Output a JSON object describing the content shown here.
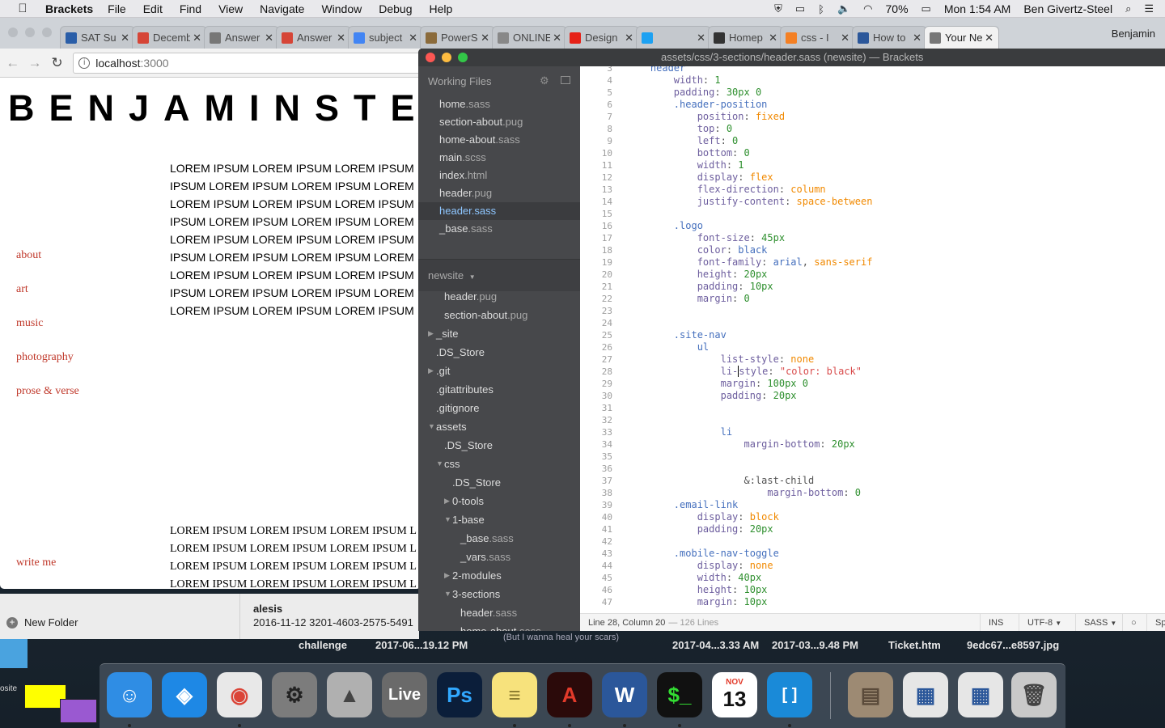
{
  "menubar": {
    "app_name": "Brackets",
    "menus": [
      "File",
      "Edit",
      "Find",
      "View",
      "Navigate",
      "Window",
      "Debug",
      "Help"
    ],
    "battery": "70%",
    "clock": "Mon 1:54 AM",
    "user": "Ben Givertz-Steel"
  },
  "chrome": {
    "tabs": [
      {
        "title": "SAT Su",
        "icon": "shield-icon",
        "color": "#2a5ea8"
      },
      {
        "title": "Decemb",
        "icon": "gmail-icon",
        "color": "#d64537"
      },
      {
        "title": "Answer",
        "icon": "document-icon",
        "color": "#777777"
      },
      {
        "title": "Answer",
        "icon": "pdf-icon",
        "color": "#d64537"
      },
      {
        "title": "subject",
        "icon": "google-icon",
        "color": "#4285f4"
      },
      {
        "title": "PowerS",
        "icon": "powerschool-icon",
        "color": "#8b6b3b"
      },
      {
        "title": "ONLINE",
        "icon": "page-icon",
        "color": "#888888"
      },
      {
        "title": "Design",
        "icon": "youtube-icon",
        "color": "#e62117"
      },
      {
        "title": "",
        "icon": "twitter-icon",
        "color": "#1da1f2"
      },
      {
        "title": "Homep",
        "icon": "grid-icon",
        "color": "#333333"
      },
      {
        "title": "css - I",
        "icon": "stack-icon",
        "color": "#f48024"
      },
      {
        "title": "How to",
        "icon": "word-icon",
        "color": "#2b579a"
      },
      {
        "title": "Your Ne",
        "icon": "document-icon",
        "color": "#777777"
      }
    ],
    "profile": "Benjamin",
    "url_host": "localhost",
    "url_port": ":3000"
  },
  "site": {
    "logo": "BENJAMINSTEEL",
    "nav": [
      "about",
      "art",
      "music",
      "photography",
      "prose & verse"
    ],
    "write_me": "write me",
    "lorem_lines": [
      "LOREM IPSUM LOREM IPSUM LOREM IPSUM",
      "IPSUM LOREM IPSUM LOREM IPSUM LOREM",
      "LOREM IPSUM LOREM IPSUM LOREM IPSUM",
      "IPSUM LOREM IPSUM LOREM IPSUM LOREM",
      "LOREM IPSUM LOREM IPSUM LOREM IPSUM",
      "IPSUM LOREM IPSUM LOREM IPSUM LOREM",
      "LOREM IPSUM LOREM IPSUM LOREM IPSUM",
      "IPSUM LOREM IPSUM LOREM IPSUM LOREM",
      "LOREM IPSUM LOREM IPSUM LOREM IPSUM"
    ],
    "lorem_lines_2": [
      "LOREM IPSUM LOREM IPSUM LOREM IPSUM L",
      "LOREM IPSUM LOREM IPSUM LOREM IPSUM L",
      "LOREM IPSUM LOREM IPSUM LOREM IPSUM L",
      "LOREM IPSUM LOREM IPSUM LOREM IPSUM L"
    ]
  },
  "finder": {
    "new_folder": "New Folder",
    "item_name": "alesis",
    "item_meta": "2016-11-12  3201-4603-2575-5491"
  },
  "brackets": {
    "title": "assets/css/3-sections/header.sass (newsite) — Brackets",
    "working_files_label": "Working Files",
    "working_files": [
      {
        "name": "home",
        "ext": ".sass",
        "selected": false
      },
      {
        "name": "section-about",
        "ext": ".pug",
        "selected": false
      },
      {
        "name": "home-about",
        "ext": ".sass",
        "selected": false
      },
      {
        "name": "main",
        "ext": ".scss",
        "selected": false
      },
      {
        "name": "index",
        "ext": ".html",
        "selected": false
      },
      {
        "name": "header",
        "ext": ".pug",
        "selected": false
      },
      {
        "name": "header",
        "ext": ".sass",
        "selected": true
      },
      {
        "name": "_base",
        "ext": ".sass",
        "selected": false
      }
    ],
    "project_name": "newsite",
    "tree": [
      {
        "name": "header",
        "ext": ".pug",
        "depth": 2,
        "twisty": ""
      },
      {
        "name": "section-about",
        "ext": ".pug",
        "depth": 2,
        "twisty": ""
      },
      {
        "name": "_site",
        "ext": "",
        "depth": 1,
        "twisty": "▶"
      },
      {
        "name": ".DS_Store",
        "ext": "",
        "depth": 1,
        "twisty": ""
      },
      {
        "name": ".git",
        "ext": "",
        "depth": 1,
        "twisty": "▶"
      },
      {
        "name": ".gitattributes",
        "ext": "",
        "depth": 1,
        "twisty": ""
      },
      {
        "name": ".gitignore",
        "ext": "",
        "depth": 1,
        "twisty": ""
      },
      {
        "name": "assets",
        "ext": "",
        "depth": 1,
        "twisty": "▼"
      },
      {
        "name": ".DS_Store",
        "ext": "",
        "depth": 2,
        "twisty": ""
      },
      {
        "name": "css",
        "ext": "",
        "depth": 2,
        "twisty": "▼"
      },
      {
        "name": ".DS_Store",
        "ext": "",
        "depth": 3,
        "twisty": ""
      },
      {
        "name": "0-tools",
        "ext": "",
        "depth": 3,
        "twisty": "▶"
      },
      {
        "name": "1-base",
        "ext": "",
        "depth": 3,
        "twisty": "▼"
      },
      {
        "name": "_base",
        "ext": ".sass",
        "depth": 4,
        "twisty": ""
      },
      {
        "name": "_vars",
        "ext": ".sass",
        "depth": 4,
        "twisty": ""
      },
      {
        "name": "2-modules",
        "ext": "",
        "depth": 3,
        "twisty": "▶"
      },
      {
        "name": "3-sections",
        "ext": "",
        "depth": 3,
        "twisty": "▼"
      },
      {
        "name": "header",
        "ext": ".sass",
        "depth": 4,
        "twisty": ""
      },
      {
        "name": "home-about",
        "ext": ".sass",
        "depth": 4,
        "twisty": ""
      }
    ],
    "code": [
      {
        "n": "3",
        "tokens": [
          [
            "    header",
            "sel"
          ]
        ]
      },
      {
        "n": "4",
        "tokens": [
          [
            "        width",
            "prop"
          ],
          [
            ": ",
            ""
          ],
          [
            "1",
            "num"
          ]
        ]
      },
      {
        "n": "5",
        "tokens": [
          [
            "        padding",
            "prop"
          ],
          [
            ": ",
            ""
          ],
          [
            "30px 0",
            "num"
          ]
        ]
      },
      {
        "n": "6",
        "tokens": [
          [
            "        .header-position",
            "sel"
          ]
        ]
      },
      {
        "n": "7",
        "tokens": [
          [
            "            position",
            "prop"
          ],
          [
            ": ",
            ""
          ],
          [
            "fixed",
            "val"
          ]
        ]
      },
      {
        "n": "8",
        "tokens": [
          [
            "            top",
            "prop"
          ],
          [
            ": ",
            ""
          ],
          [
            "0",
            "num"
          ]
        ]
      },
      {
        "n": "9",
        "tokens": [
          [
            "            left",
            "prop"
          ],
          [
            ": ",
            ""
          ],
          [
            "0",
            "num"
          ]
        ]
      },
      {
        "n": "10",
        "tokens": [
          [
            "            bottom",
            "prop"
          ],
          [
            ": ",
            ""
          ],
          [
            "0",
            "num"
          ]
        ]
      },
      {
        "n": "11",
        "tokens": [
          [
            "            width",
            "prop"
          ],
          [
            ": ",
            ""
          ],
          [
            "1",
            "num"
          ]
        ]
      },
      {
        "n": "12",
        "tokens": [
          [
            "            display",
            "prop"
          ],
          [
            ": ",
            ""
          ],
          [
            "flex",
            "val"
          ]
        ]
      },
      {
        "n": "13",
        "tokens": [
          [
            "            flex-direction",
            "prop"
          ],
          [
            ": ",
            ""
          ],
          [
            "column",
            "val"
          ]
        ]
      },
      {
        "n": "14",
        "tokens": [
          [
            "            justify-content",
            "prop"
          ],
          [
            ": ",
            ""
          ],
          [
            "space-between",
            "val"
          ]
        ]
      },
      {
        "n": "15",
        "tokens": []
      },
      {
        "n": "16",
        "tokens": [
          [
            "        .logo",
            "sel"
          ]
        ]
      },
      {
        "n": "17",
        "tokens": [
          [
            "            font-size",
            "prop"
          ],
          [
            ": ",
            ""
          ],
          [
            "45px",
            "num"
          ]
        ]
      },
      {
        "n": "18",
        "tokens": [
          [
            "            color",
            "prop"
          ],
          [
            ": ",
            ""
          ],
          [
            "black",
            "sel"
          ]
        ]
      },
      {
        "n": "19",
        "tokens": [
          [
            "            font-family",
            "prop"
          ],
          [
            ": ",
            ""
          ],
          [
            "arial",
            "sel"
          ],
          [
            ", ",
            ""
          ],
          [
            "sans-serif",
            "val"
          ]
        ]
      },
      {
        "n": "20",
        "tokens": [
          [
            "            height",
            "prop"
          ],
          [
            ": ",
            ""
          ],
          [
            "20px",
            "num"
          ]
        ]
      },
      {
        "n": "21",
        "tokens": [
          [
            "            padding",
            "prop"
          ],
          [
            ": ",
            ""
          ],
          [
            "10px",
            "num"
          ]
        ]
      },
      {
        "n": "22",
        "tokens": [
          [
            "            margin",
            "prop"
          ],
          [
            ": ",
            ""
          ],
          [
            "0",
            "num"
          ]
        ]
      },
      {
        "n": "23",
        "tokens": []
      },
      {
        "n": "24",
        "tokens": []
      },
      {
        "n": "25",
        "tokens": [
          [
            "        .site-nav",
            "sel"
          ]
        ]
      },
      {
        "n": "26",
        "tokens": [
          [
            "            ul",
            "sel"
          ]
        ]
      },
      {
        "n": "27",
        "tokens": [
          [
            "                list-style",
            "prop"
          ],
          [
            ": ",
            ""
          ],
          [
            "none",
            "val"
          ]
        ]
      },
      {
        "n": "28",
        "tokens": [
          [
            "                li-",
            "prop"
          ],
          [
            "|",
            "cursor"
          ],
          [
            "style",
            "prop"
          ],
          [
            ": ",
            ""
          ],
          [
            "\"color: black\"",
            "str"
          ]
        ]
      },
      {
        "n": "29",
        "tokens": [
          [
            "                margin",
            "prop"
          ],
          [
            ": ",
            ""
          ],
          [
            "100px 0",
            "num"
          ]
        ]
      },
      {
        "n": "30",
        "tokens": [
          [
            "                padding",
            "prop"
          ],
          [
            ": ",
            ""
          ],
          [
            "20px",
            "num"
          ]
        ]
      },
      {
        "n": "31",
        "tokens": []
      },
      {
        "n": "32",
        "tokens": []
      },
      {
        "n": "33",
        "tokens": [
          [
            "                li",
            "sel"
          ]
        ]
      },
      {
        "n": "34",
        "tokens": [
          [
            "                    margin-bottom",
            "prop"
          ],
          [
            ": ",
            ""
          ],
          [
            "20px",
            "num"
          ]
        ]
      },
      {
        "n": "35",
        "tokens": []
      },
      {
        "n": "36",
        "tokens": []
      },
      {
        "n": "37",
        "tokens": [
          [
            "                    &:last-child",
            ""
          ]
        ]
      },
      {
        "n": "38",
        "tokens": [
          [
            "                        margin-bottom",
            "prop"
          ],
          [
            ": ",
            ""
          ],
          [
            "0",
            "num"
          ]
        ]
      },
      {
        "n": "39",
        "tokens": [
          [
            "        .email-link",
            "sel"
          ]
        ]
      },
      {
        "n": "40",
        "tokens": [
          [
            "            display",
            "prop"
          ],
          [
            ": ",
            ""
          ],
          [
            "block",
            "val"
          ]
        ]
      },
      {
        "n": "41",
        "tokens": [
          [
            "            padding",
            "prop"
          ],
          [
            ": ",
            ""
          ],
          [
            "20px",
            "num"
          ]
        ]
      },
      {
        "n": "42",
        "tokens": []
      },
      {
        "n": "43",
        "tokens": [
          [
            "        .mobile-nav-toggle",
            "sel"
          ]
        ]
      },
      {
        "n": "44",
        "tokens": [
          [
            "            display",
            "prop"
          ],
          [
            ": ",
            ""
          ],
          [
            "none",
            "val"
          ]
        ]
      },
      {
        "n": "45",
        "tokens": [
          [
            "            width",
            "prop"
          ],
          [
            ": ",
            ""
          ],
          [
            "40px",
            "num"
          ]
        ]
      },
      {
        "n": "46",
        "tokens": [
          [
            "            height",
            "prop"
          ],
          [
            ": ",
            ""
          ],
          [
            "10px",
            "num"
          ]
        ]
      },
      {
        "n": "47",
        "tokens": [
          [
            "            margin",
            "prop"
          ],
          [
            ": ",
            ""
          ],
          [
            "10px",
            "num"
          ]
        ]
      }
    ],
    "status": {
      "position": "Line 28, Column 20",
      "lines": "— 126 Lines",
      "mode": "INS",
      "encoding": "UTF-8",
      "language": "SASS",
      "spaces": "Sp"
    }
  },
  "desktop": {
    "items": [
      {
        "label": "challenge"
      },
      {
        "label": "2017-06...19.12 PM"
      },
      {
        "label": "(But I wanna heal your scars)"
      },
      {
        "label": "2017-04...3.33 AM"
      },
      {
        "label": "2017-03...9.48 PM"
      },
      {
        "label": "Ticket.htm"
      },
      {
        "label": "9edc67...e8597.jpg"
      }
    ],
    "small_label": "osite"
  },
  "dock": {
    "apps": [
      {
        "name": "Finder",
        "glyph": "☺",
        "bg": "#2f8de4",
        "fg": "#ffffff",
        "running": true
      },
      {
        "name": "Safari",
        "glyph": "◈",
        "bg": "#1e88e5",
        "fg": "#ffffff",
        "running": false
      },
      {
        "name": "Chrome",
        "glyph": "◉",
        "bg": "#e8e8e8",
        "fg": "#db4437",
        "running": true
      },
      {
        "name": "System Preferences",
        "glyph": "⚙",
        "bg": "#7c7c7c",
        "fg": "#222222",
        "running": false
      },
      {
        "name": "Archive Utility",
        "glyph": "▲",
        "bg": "#b0b0b0",
        "fg": "#444444",
        "running": false
      },
      {
        "name": "Live",
        "glyph": "Live",
        "bg": "#6a6a6a",
        "fg": "#ffffff",
        "running": false
      },
      {
        "name": "Photoshop",
        "glyph": "Ps",
        "bg": "#0b1e3a",
        "fg": "#31a8ff",
        "running": false
      },
      {
        "name": "Notes",
        "glyph": "≡",
        "bg": "#f7e27c",
        "fg": "#8a7b2e",
        "running": true
      },
      {
        "name": "Acrobat",
        "glyph": "A",
        "bg": "#2b0a0a",
        "fg": "#e23a2a",
        "running": true
      },
      {
        "name": "Word",
        "glyph": "W",
        "bg": "#2b579a",
        "fg": "#ffffff",
        "running": true
      },
      {
        "name": "Terminal",
        "glyph": "$_",
        "bg": "#111111",
        "fg": "#33dd33",
        "running": true
      },
      {
        "name": "Calendar",
        "glyph": "13",
        "bg": "#ffffff",
        "fg": "#111111",
        "running": false
      },
      {
        "name": "Brackets",
        "glyph": "[ ]",
        "bg": "#1a8ad8",
        "fg": "#ffffff",
        "running": true
      },
      {
        "name": "Stack 1",
        "glyph": "▤",
        "bg": "#9d8a73",
        "fg": "#5a4a3a",
        "running": false
      },
      {
        "name": "Document 1",
        "glyph": "▦",
        "bg": "#e6e6e6",
        "fg": "#2b579a",
        "running": false
      },
      {
        "name": "Document 2",
        "glyph": "▦",
        "bg": "#e6e6e6",
        "fg": "#2b579a",
        "running": false
      },
      {
        "name": "Trash",
        "glyph": "🗑",
        "bg": "#c9c9c9",
        "fg": "#444444",
        "running": false
      }
    ],
    "calendar_month": "NOV"
  }
}
